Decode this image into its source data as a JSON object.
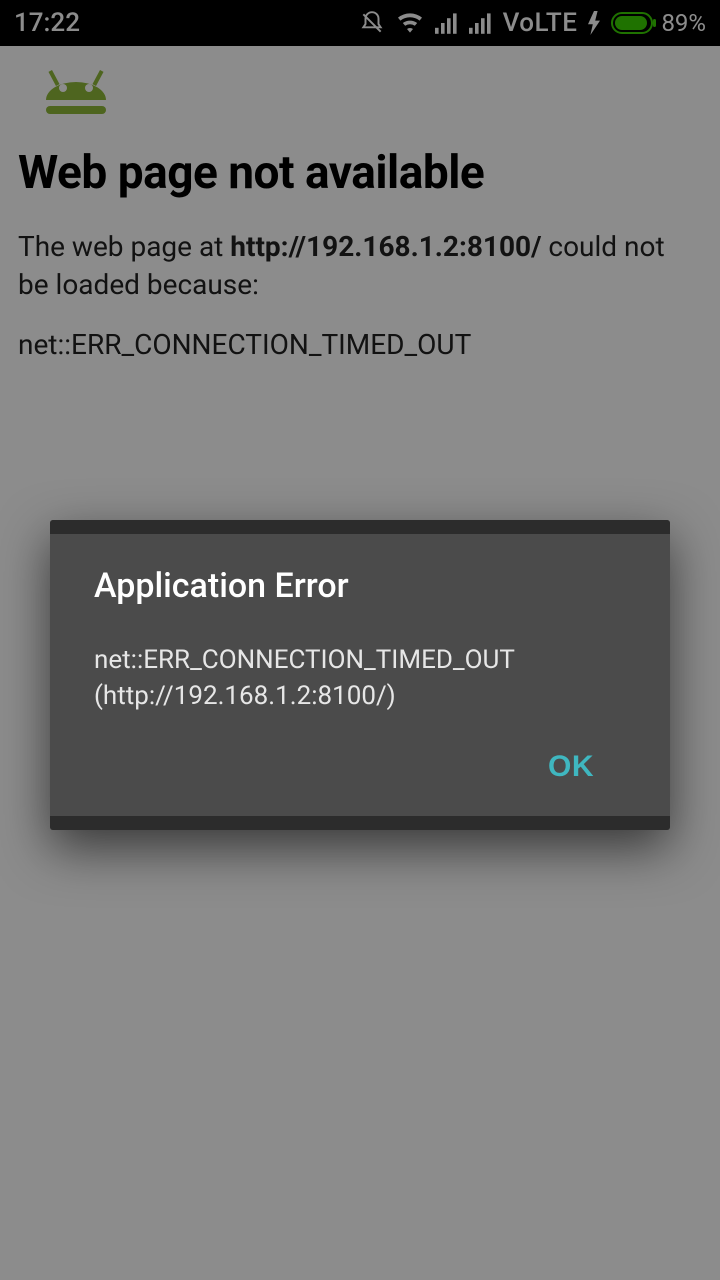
{
  "status": {
    "time": "17:22",
    "volte": "VoLTE",
    "battery_pct": "89%"
  },
  "page": {
    "heading": "Web page not available",
    "body_prefix": "The web page at ",
    "url": "http://192.168.1.2:8100/",
    "body_suffix": " could not be loaded because:",
    "error_code": "net::ERR_CONNECTION_TIMED_OUT"
  },
  "dialog": {
    "title": "Application Error",
    "message_line1": "net::ERR_CONNECTION_TIMED_OUT",
    "message_line2": "(http://192.168.1.2:8100/)",
    "ok_label": "OK"
  }
}
